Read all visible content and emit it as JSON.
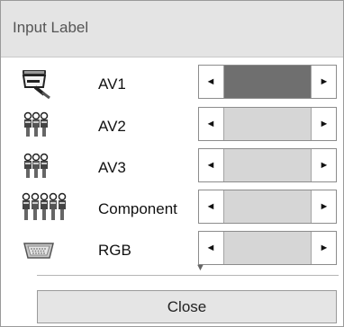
{
  "dialog": {
    "title": "Input Label",
    "close_label": "Close"
  },
  "inputs": [
    {
      "label": "AV1",
      "icon": "scart-connector-icon",
      "selected": true
    },
    {
      "label": "AV2",
      "icon": "rca-av-connector-icon",
      "selected": false
    },
    {
      "label": "AV3",
      "icon": "rca-av-connector-icon",
      "selected": false
    },
    {
      "label": "Component",
      "icon": "component-connector-icon",
      "selected": false
    },
    {
      "label": "RGB",
      "icon": "rgb-vga-connector-icon",
      "selected": false
    }
  ],
  "glyphs": {
    "left_arrow": "◄",
    "right_arrow": "►",
    "more_arrow": "▼"
  },
  "colors": {
    "title_bg": "#e4e4e4",
    "field_bg": "#d6d6d6",
    "field_selected_bg": "#6f6f6f"
  }
}
